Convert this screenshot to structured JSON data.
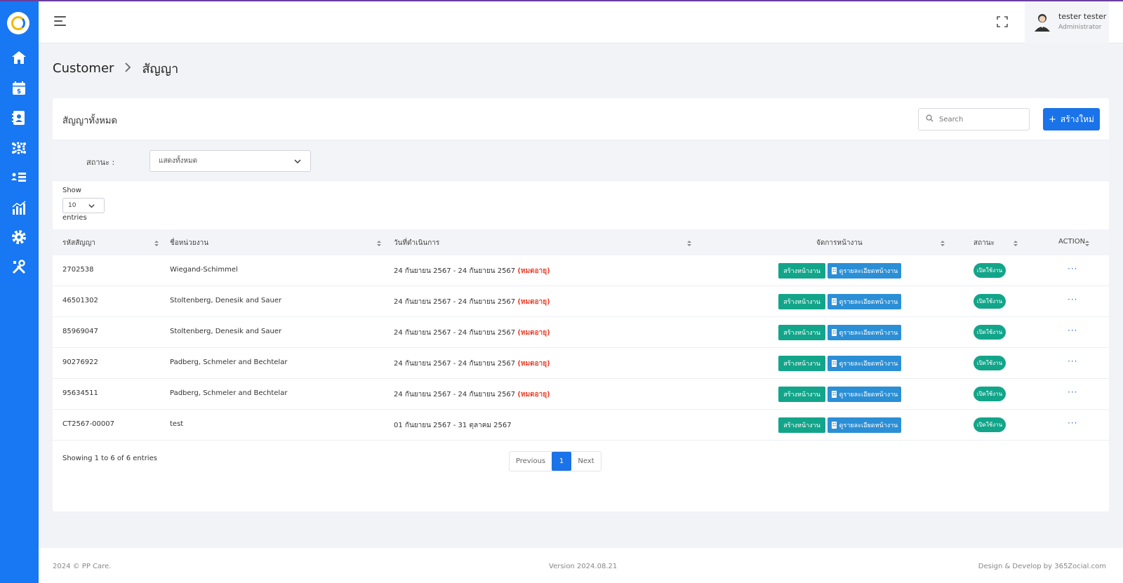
{
  "header": {
    "user_name": "tester tester",
    "user_role": "Administrator"
  },
  "sidebar": {
    "items": [
      {
        "icon": "home-icon"
      },
      {
        "icon": "calendar-dollar-icon"
      },
      {
        "icon": "contact-book-icon"
      },
      {
        "icon": "team-gear-icon"
      },
      {
        "icon": "user-list-icon"
      },
      {
        "icon": "bar-chart-icon"
      },
      {
        "icon": "settings-icon"
      },
      {
        "icon": "tools-icon"
      }
    ]
  },
  "breadcrumb": {
    "parent": "Customer",
    "current": "สัญญา"
  },
  "card": {
    "title": "สัญญาทั้งหมด",
    "search_placeholder": "Search",
    "create_label": "สร้างใหม่",
    "filter_label": "สถานะ :",
    "filter_value": "แสดงทั้งหมด",
    "show_label": "Show",
    "page_length": "10",
    "entries_label": "entries"
  },
  "table": {
    "columns": [
      "รหัสสัญญา",
      "ชื่อหน่วยงาน",
      "วันที่ดำเนินการ",
      "จัดการหน้างาน",
      "สถานะ",
      "ACTION"
    ],
    "rows": [
      {
        "code": "2702538",
        "org": "Wiegand-Schimmel",
        "date": "24 กันยายน 2567 - 24 กันยายน 2567",
        "note": "(หมดอายุ)",
        "status": "เปิดใช้งาน"
      },
      {
        "code": "46501302",
        "org": "Stoltenberg, Denesik and Sauer",
        "date": "24 กันยายน 2567 - 24 กันยายน 2567",
        "note": "(หมดอายุ)",
        "status": "เปิดใช้งาน"
      },
      {
        "code": "85969047",
        "org": "Stoltenberg, Denesik and Sauer",
        "date": "24 กันยายน 2567 - 24 กันยายน 2567",
        "note": "(หมดอายุ)",
        "status": "เปิดใช้งาน"
      },
      {
        "code": "90276922",
        "org": "Padberg, Schmeler and Bechtelar",
        "date": "24 กันยายน 2567 - 24 กันยายน 2567",
        "note": "(หมดอายุ)",
        "status": "เปิดใช้งาน"
      },
      {
        "code": "95634511",
        "org": "Padberg, Schmeler and Bechtelar",
        "date": "24 กันยายน 2567 - 24 กันยายน 2567",
        "note": "(หมดอายุ)",
        "status": "เปิดใช้งาน"
      },
      {
        "code": "CT2567-00007",
        "org": "test",
        "date": "01 กันยายน 2567 - 31 ตุลาคม 2567",
        "note": "",
        "status": "เปิดใช้งาน"
      }
    ],
    "create_job_label": "สร้างหน้างาน",
    "view_job_label": "ดูรายละเอียดหน้างาน",
    "action_label": "···"
  },
  "pagination": {
    "info": "Showing 1 to 6 of 6 entries",
    "previous": "Previous",
    "page": "1",
    "next": "Next"
  },
  "footer": {
    "copyright": "2024 © PP Care.",
    "version": "Version 2024.08.21",
    "credit": "Design & Develop by 365Zocial.com"
  },
  "colors": {
    "sidebar": "#1877f2",
    "primary": "#1a73e8",
    "success": "#12a58a",
    "info": "#2b8fd6",
    "danger": "#e8412c"
  }
}
